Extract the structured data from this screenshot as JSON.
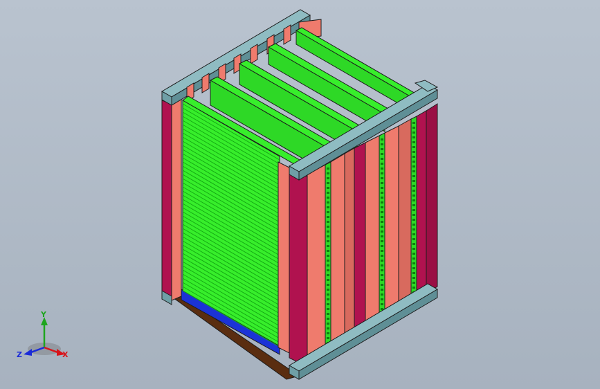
{
  "viewport": {
    "background_top": "#b9c3cf",
    "background_bottom": "#a7b2bf"
  },
  "model": {
    "colors": {
      "frame_face": "#6f9fa6",
      "frame_top": "#8fbcc2",
      "frame_dark": "#3f6e75",
      "post_crimson": "#b0124f",
      "post_crimson_dark": "#7e0b39",
      "post_salmon": "#ef7b6d",
      "post_salmon_dark": "#c85a4f",
      "plate_green": "#37ee2b",
      "plate_green_dark": "#14a913",
      "plate_line": "#0f7d10",
      "base_blue": "#1b33d6",
      "base_brown": "#5a2d10",
      "edge": "#1d1d1d"
    }
  },
  "triad": {
    "x_label": "X",
    "y_label": "Y",
    "z_label": "Z",
    "x_color": "#d8141a",
    "y_color": "#1ea51e",
    "z_color": "#1a2bd8"
  }
}
